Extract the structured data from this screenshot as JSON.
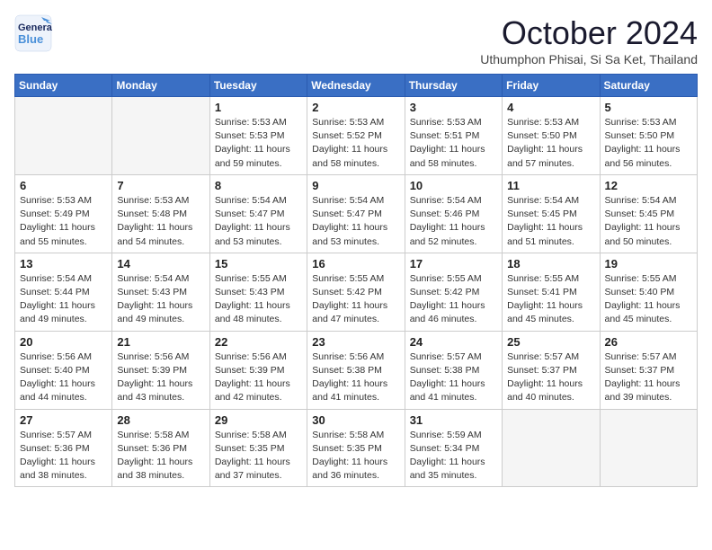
{
  "header": {
    "logo_general": "General",
    "logo_blue": "Blue",
    "month_title": "October 2024",
    "subtitle": "Uthumphon Phisai, Si Sa Ket, Thailand"
  },
  "weekdays": [
    "Sunday",
    "Monday",
    "Tuesday",
    "Wednesday",
    "Thursday",
    "Friday",
    "Saturday"
  ],
  "weeks": [
    [
      {
        "day": "",
        "empty": true
      },
      {
        "day": "",
        "empty": true
      },
      {
        "day": "1",
        "sunrise": "Sunrise: 5:53 AM",
        "sunset": "Sunset: 5:53 PM",
        "daylight": "Daylight: 11 hours and 59 minutes."
      },
      {
        "day": "2",
        "sunrise": "Sunrise: 5:53 AM",
        "sunset": "Sunset: 5:52 PM",
        "daylight": "Daylight: 11 hours and 58 minutes."
      },
      {
        "day": "3",
        "sunrise": "Sunrise: 5:53 AM",
        "sunset": "Sunset: 5:51 PM",
        "daylight": "Daylight: 11 hours and 58 minutes."
      },
      {
        "day": "4",
        "sunrise": "Sunrise: 5:53 AM",
        "sunset": "Sunset: 5:50 PM",
        "daylight": "Daylight: 11 hours and 57 minutes."
      },
      {
        "day": "5",
        "sunrise": "Sunrise: 5:53 AM",
        "sunset": "Sunset: 5:50 PM",
        "daylight": "Daylight: 11 hours and 56 minutes."
      }
    ],
    [
      {
        "day": "6",
        "sunrise": "Sunrise: 5:53 AM",
        "sunset": "Sunset: 5:49 PM",
        "daylight": "Daylight: 11 hours and 55 minutes."
      },
      {
        "day": "7",
        "sunrise": "Sunrise: 5:53 AM",
        "sunset": "Sunset: 5:48 PM",
        "daylight": "Daylight: 11 hours and 54 minutes."
      },
      {
        "day": "8",
        "sunrise": "Sunrise: 5:54 AM",
        "sunset": "Sunset: 5:47 PM",
        "daylight": "Daylight: 11 hours and 53 minutes."
      },
      {
        "day": "9",
        "sunrise": "Sunrise: 5:54 AM",
        "sunset": "Sunset: 5:47 PM",
        "daylight": "Daylight: 11 hours and 53 minutes."
      },
      {
        "day": "10",
        "sunrise": "Sunrise: 5:54 AM",
        "sunset": "Sunset: 5:46 PM",
        "daylight": "Daylight: 11 hours and 52 minutes."
      },
      {
        "day": "11",
        "sunrise": "Sunrise: 5:54 AM",
        "sunset": "Sunset: 5:45 PM",
        "daylight": "Daylight: 11 hours and 51 minutes."
      },
      {
        "day": "12",
        "sunrise": "Sunrise: 5:54 AM",
        "sunset": "Sunset: 5:45 PM",
        "daylight": "Daylight: 11 hours and 50 minutes."
      }
    ],
    [
      {
        "day": "13",
        "sunrise": "Sunrise: 5:54 AM",
        "sunset": "Sunset: 5:44 PM",
        "daylight": "Daylight: 11 hours and 49 minutes."
      },
      {
        "day": "14",
        "sunrise": "Sunrise: 5:54 AM",
        "sunset": "Sunset: 5:43 PM",
        "daylight": "Daylight: 11 hours and 49 minutes."
      },
      {
        "day": "15",
        "sunrise": "Sunrise: 5:55 AM",
        "sunset": "Sunset: 5:43 PM",
        "daylight": "Daylight: 11 hours and 48 minutes."
      },
      {
        "day": "16",
        "sunrise": "Sunrise: 5:55 AM",
        "sunset": "Sunset: 5:42 PM",
        "daylight": "Daylight: 11 hours and 47 minutes."
      },
      {
        "day": "17",
        "sunrise": "Sunrise: 5:55 AM",
        "sunset": "Sunset: 5:42 PM",
        "daylight": "Daylight: 11 hours and 46 minutes."
      },
      {
        "day": "18",
        "sunrise": "Sunrise: 5:55 AM",
        "sunset": "Sunset: 5:41 PM",
        "daylight": "Daylight: 11 hours and 45 minutes."
      },
      {
        "day": "19",
        "sunrise": "Sunrise: 5:55 AM",
        "sunset": "Sunset: 5:40 PM",
        "daylight": "Daylight: 11 hours and 45 minutes."
      }
    ],
    [
      {
        "day": "20",
        "sunrise": "Sunrise: 5:56 AM",
        "sunset": "Sunset: 5:40 PM",
        "daylight": "Daylight: 11 hours and 44 minutes."
      },
      {
        "day": "21",
        "sunrise": "Sunrise: 5:56 AM",
        "sunset": "Sunset: 5:39 PM",
        "daylight": "Daylight: 11 hours and 43 minutes."
      },
      {
        "day": "22",
        "sunrise": "Sunrise: 5:56 AM",
        "sunset": "Sunset: 5:39 PM",
        "daylight": "Daylight: 11 hours and 42 minutes."
      },
      {
        "day": "23",
        "sunrise": "Sunrise: 5:56 AM",
        "sunset": "Sunset: 5:38 PM",
        "daylight": "Daylight: 11 hours and 41 minutes."
      },
      {
        "day": "24",
        "sunrise": "Sunrise: 5:57 AM",
        "sunset": "Sunset: 5:38 PM",
        "daylight": "Daylight: 11 hours and 41 minutes."
      },
      {
        "day": "25",
        "sunrise": "Sunrise: 5:57 AM",
        "sunset": "Sunset: 5:37 PM",
        "daylight": "Daylight: 11 hours and 40 minutes."
      },
      {
        "day": "26",
        "sunrise": "Sunrise: 5:57 AM",
        "sunset": "Sunset: 5:37 PM",
        "daylight": "Daylight: 11 hours and 39 minutes."
      }
    ],
    [
      {
        "day": "27",
        "sunrise": "Sunrise: 5:57 AM",
        "sunset": "Sunset: 5:36 PM",
        "daylight": "Daylight: 11 hours and 38 minutes."
      },
      {
        "day": "28",
        "sunrise": "Sunrise: 5:58 AM",
        "sunset": "Sunset: 5:36 PM",
        "daylight": "Daylight: 11 hours and 38 minutes."
      },
      {
        "day": "29",
        "sunrise": "Sunrise: 5:58 AM",
        "sunset": "Sunset: 5:35 PM",
        "daylight": "Daylight: 11 hours and 37 minutes."
      },
      {
        "day": "30",
        "sunrise": "Sunrise: 5:58 AM",
        "sunset": "Sunset: 5:35 PM",
        "daylight": "Daylight: 11 hours and 36 minutes."
      },
      {
        "day": "31",
        "sunrise": "Sunrise: 5:59 AM",
        "sunset": "Sunset: 5:34 PM",
        "daylight": "Daylight: 11 hours and 35 minutes."
      },
      {
        "day": "",
        "empty": true
      },
      {
        "day": "",
        "empty": true
      }
    ]
  ]
}
